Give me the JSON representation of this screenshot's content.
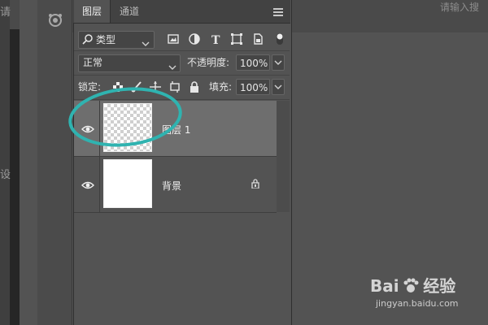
{
  "app_background": {
    "left_text_top": "请",
    "left_text_mid": "设",
    "right_hint": "请输入搜"
  },
  "panel": {
    "tabs": [
      {
        "label": "图层",
        "active": true
      },
      {
        "label": "通道",
        "active": false
      }
    ],
    "filter": {
      "label": "类型",
      "icons": [
        "image-filter-icon",
        "adjustment-filter-icon",
        "text-filter-icon",
        "shape-filter-icon",
        "smart-object-filter-icon",
        "filter-toggle-icon"
      ]
    },
    "blend_mode": "正常",
    "opacity": {
      "label": "不透明度:",
      "value": "100%"
    },
    "lock": {
      "label": "锁定:",
      "icons": [
        "lock-transparent-icon",
        "lock-image-icon",
        "lock-position-icon",
        "lock-artboard-icon",
        "lock-all-icon"
      ]
    },
    "fill": {
      "label": "填充:",
      "value": "100%"
    },
    "layers": [
      {
        "name": "图层 1",
        "visible": true,
        "selected": true,
        "thumbnail": "transparent"
      },
      {
        "name": "背景",
        "visible": true,
        "selected": false,
        "thumbnail": "white",
        "locked": true
      }
    ]
  },
  "annotation": {
    "color": "#2fb3b0"
  },
  "watermark": {
    "brand": "Bai",
    "brand_suffix": "经验",
    "url": "jingyan.baidu.com"
  }
}
